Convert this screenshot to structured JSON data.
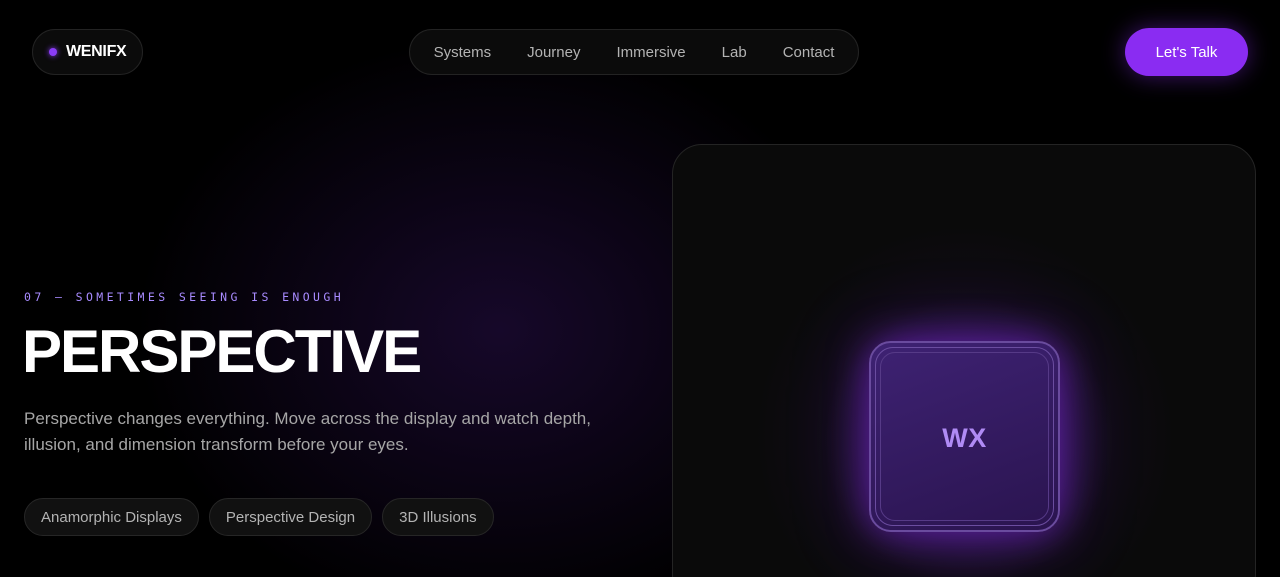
{
  "brand": {
    "name": "WENIFX"
  },
  "nav": {
    "items": [
      "Systems",
      "Journey",
      "Immersive",
      "Lab",
      "Contact"
    ]
  },
  "cta": {
    "label": "Let's Talk"
  },
  "hero": {
    "eyebrow": "07 — SOMETIMES SEEING IS ENOUGH",
    "title": "PERSPECTIVE",
    "description": "Perspective changes everything. Move across the display and watch depth, illusion, and dimension transform before your eyes.",
    "tags": [
      "Anamorphic Displays",
      "Perspective Design",
      "3D Illusions"
    ]
  },
  "showcase": {
    "monogram": "WX"
  },
  "colors": {
    "accent": "#8a2cf2",
    "eyebrow": "#a88bff",
    "background": "#000000"
  }
}
